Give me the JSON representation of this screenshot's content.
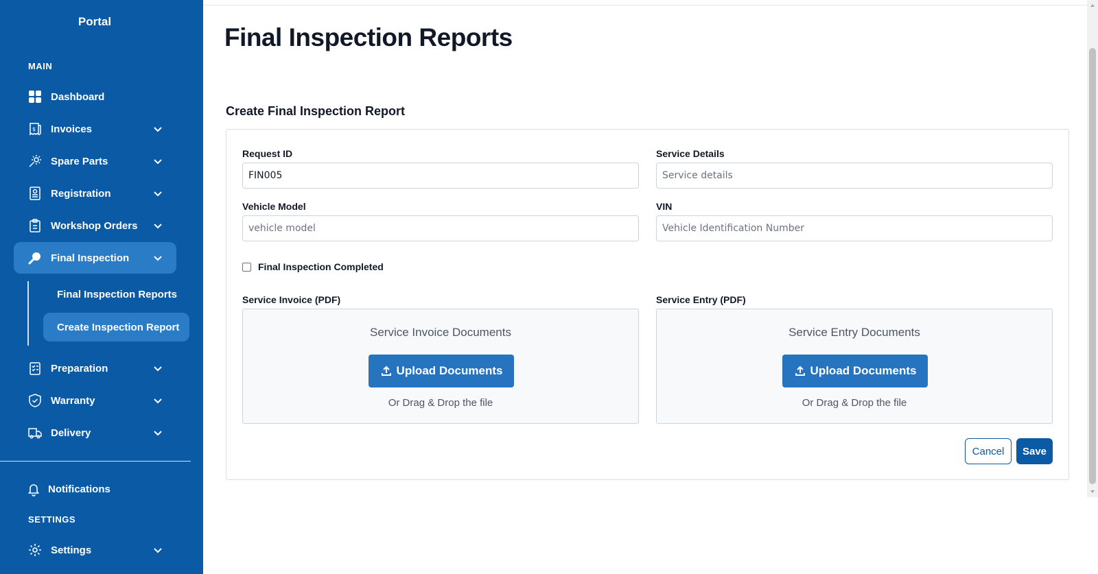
{
  "sidebar": {
    "brand": "Portal",
    "main_label": "MAIN",
    "items": [
      {
        "label": "Dashboard",
        "icon": "dashboard-icon"
      },
      {
        "label": "Invoices",
        "icon": "invoice-icon"
      },
      {
        "label": "Spare Parts",
        "icon": "gear-parts-icon"
      },
      {
        "label": "Registration",
        "icon": "registration-icon"
      },
      {
        "label": "Workshop Orders",
        "icon": "clipboard-icon"
      },
      {
        "label": "Final Inspection",
        "icon": "search-icon"
      },
      {
        "label": "Preparation",
        "icon": "checklist-icon"
      },
      {
        "label": "Warranty",
        "icon": "shield-icon"
      },
      {
        "label": "Delivery",
        "icon": "truck-icon"
      }
    ],
    "sub_items": [
      {
        "label": "Final Inspection Reports"
      },
      {
        "label": "Create Inspection Report"
      }
    ],
    "notifications": "Notifications",
    "settings_label": "SETTINGS",
    "settings": "Settings",
    "colors": {
      "background": "#0a5aa6",
      "active": "#2b7cc7"
    }
  },
  "page": {
    "title": "Final Inspection Reports",
    "card_title": "Create Final Inspection Report"
  },
  "form": {
    "request_id": {
      "label": "Request ID",
      "value": "FIN005"
    },
    "service_details": {
      "label": "Service Details",
      "placeholder": "Service details"
    },
    "vehicle_model": {
      "label": "Vehicle Model",
      "placeholder": "vehicle model"
    },
    "vin": {
      "label": "VIN",
      "placeholder": "Vehicle Identification Number"
    },
    "completed_label": "Final Inspection Completed",
    "service_invoice": {
      "label": "Service Invoice (PDF)",
      "title": "Service Invoice Documents",
      "button": "Upload Documents",
      "hint": "Or Drag & Drop the file"
    },
    "service_entry": {
      "label": "Service Entry (PDF)",
      "title": "Service Entry Documents",
      "button": "Upload Documents",
      "hint": "Or Drag & Drop the file"
    },
    "cancel": "Cancel",
    "save": "Save"
  }
}
